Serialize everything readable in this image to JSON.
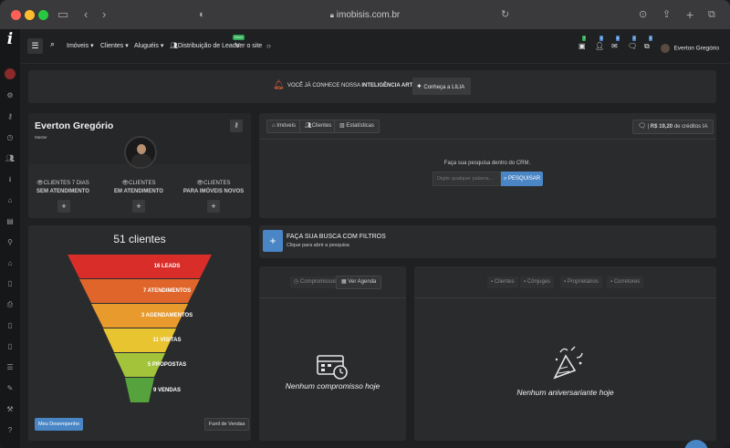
{
  "browser": {
    "url": "imobisis.com.br"
  },
  "nav": {
    "imoveis": "Imóveis",
    "clientes": "Clientes",
    "alugueis": "Aluguéis",
    "distribuicao": "Distribuição de Leads",
    "novo_badge": "Novo",
    "ver_site": "Ver o site",
    "user_name": "Everton Gregório",
    "badges": [
      "7",
      "3",
      "6",
      "2",
      "5"
    ]
  },
  "banner": {
    "text_prefix": "VOCÊ JÁ CONHECE NOSSA ",
    "text_bold": "INTELIGÊNCIA ARTIFICIAL",
    "text_suffix": "?",
    "button": "Conheça a LILIA"
  },
  "profile": {
    "name": "Everton Gregório",
    "role": "Master",
    "stats": [
      {
        "line1": "CLIENTES 7 DIAS",
        "line2": "SEM ATENDIMENTO"
      },
      {
        "line1": "CLIENTES",
        "line2": "EM ATENDIMENTO"
      },
      {
        "line1": "CLIENTES",
        "line2": "PARA IMÓVEIS NOVOS"
      }
    ]
  },
  "search": {
    "tabs": [
      "Imóveis",
      "Clientes",
      "Estatísticas"
    ],
    "credits_value": "R$ 19,20",
    "credits_label": "de créditos IA",
    "prompt": "Faça sua pesquisa dentro do CRM.",
    "placeholder": "Digite qualquer palavra...",
    "button": "PESQUISAR"
  },
  "funnel": {
    "title": "51 clientes",
    "levels": [
      {
        "label": "16 LEADS",
        "value": 16,
        "color": "#d92d2a"
      },
      {
        "label": "7 ATENDIMENTOS",
        "value": 7,
        "color": "#e0652a"
      },
      {
        "label": "3 AGENDAMENTOS",
        "value": 3,
        "color": "#e89a2d"
      },
      {
        "label": "11 VISITAS",
        "value": 11,
        "color": "#e8c431"
      },
      {
        "label": "5 PROPOSTAS",
        "value": 5,
        "color": "#a2c33a"
      },
      {
        "label": "9 VENDAS",
        "value": 9,
        "color": "#56a33d"
      }
    ],
    "btn_left": "Meu Desempenho",
    "btn_right": "Funil de Vendas"
  },
  "filters": {
    "title": "FAÇA SUA BUSCA COM FILTROS",
    "subtitle": "Clique para abrir a pesquisa"
  },
  "agenda": {
    "tabs": [
      "Compromissos",
      "Ver Agenda"
    ],
    "empty": "Nenhum compromisso hoje"
  },
  "birthdays": {
    "tabs": [
      "Clientes",
      "Cônjuges",
      "Proprietários",
      "Corretores"
    ],
    "empty": "Nenhum aniversariante hoje"
  },
  "colors": {
    "accent": "#4a86c5",
    "panel": "#2a2b2d",
    "bg": "#1f2022"
  }
}
